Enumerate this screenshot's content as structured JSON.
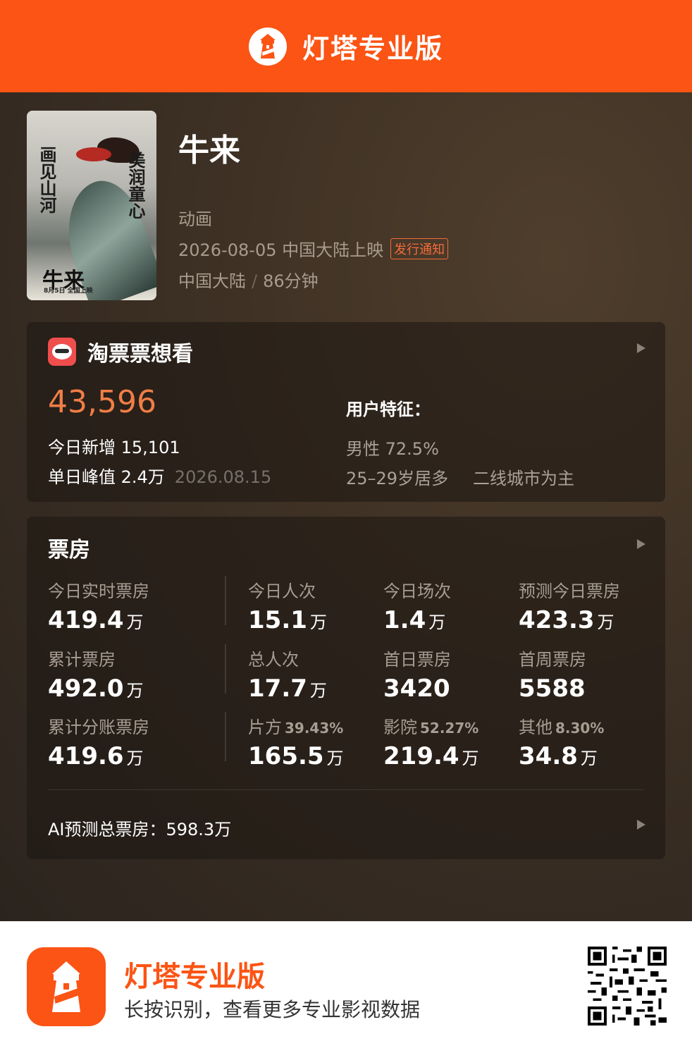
{
  "header": {
    "title": "灯塔专业版"
  },
  "movie": {
    "title": "牛来",
    "genre": "动画",
    "release_date": "2026-08-05 中国大陆上映",
    "release_notice": "发行通知",
    "region": "中国大陆",
    "separator": "/",
    "duration": "86分钟",
    "poster": {
      "vertical_text_left": "画见山河",
      "vertical_text_right": "美润童心",
      "title": "牛来",
      "date_text": "8月5日 全国上映"
    }
  },
  "want_to_see": {
    "source": "淘票票想看",
    "count": "43,596",
    "today_new": "今日新增 15,101",
    "peak_label": "单日峰值 2.4万",
    "peak_date": "2026.08.15",
    "features_title": "用户特征：",
    "gender": "男性 72.5%",
    "age": "25–29岁居多",
    "city": "二线城市为主"
  },
  "box_office": {
    "title": "票房",
    "rows": [
      [
        {
          "label": "今日实时票房",
          "value": "419.4",
          "unit": "万"
        },
        {
          "label": "今日人次",
          "value": "15.1",
          "unit": "万"
        },
        {
          "label": "今日场次",
          "value": "1.4",
          "unit": "万"
        },
        {
          "label": "预测今日票房",
          "value": "423.3",
          "unit": "万"
        }
      ],
      [
        {
          "label": "累计票房",
          "value": "492.0",
          "unit": "万"
        },
        {
          "label": "总人次",
          "value": "17.7",
          "unit": "万"
        },
        {
          "label": "首日票房",
          "value": "3420",
          "unit": ""
        },
        {
          "label": "首周票房",
          "value": "5588",
          "unit": ""
        }
      ],
      [
        {
          "label": "累计分账票房",
          "pct": "",
          "value": "419.6",
          "unit": "万"
        },
        {
          "label": "片方",
          "pct": "39.43%",
          "value": "165.5",
          "unit": "万"
        },
        {
          "label": "影院",
          "pct": "52.27%",
          "value": "219.4",
          "unit": "万"
        },
        {
          "label": "其他",
          "pct": "8.30%",
          "value": "34.8",
          "unit": "万"
        }
      ]
    ],
    "ai_forecast": "AI预测总票房：598.3万"
  },
  "footer": {
    "brand": "灯塔专业版",
    "slogan": "长按识别，查看更多专业影视数据"
  },
  "colors": {
    "brand_orange": "#fb5414",
    "count_orange": "#f07e46",
    "taopiao_red": "#f04d4d"
  },
  "icons": [
    "lighthouse-logo-icon",
    "taopiaopiao-icon",
    "arrow-right-icon",
    "qr-code"
  ]
}
